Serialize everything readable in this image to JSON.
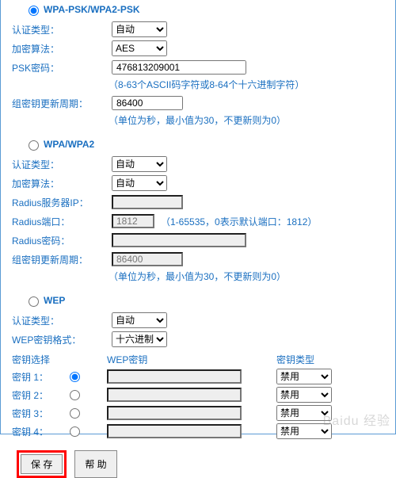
{
  "sec1": {
    "title": "WPA-PSK/WPA2-PSK",
    "radio_checked": true,
    "auth_label": "认证类型：",
    "auth_value": "自动",
    "enc_label": "加密算法：",
    "enc_value": "AES",
    "psk_label": "PSK密码：",
    "psk_value": "476813209001",
    "psk_hint": "（8-63个ASCII码字符或8-64个十六进制字符）",
    "gkey_label": "组密钥更新周期：",
    "gkey_value": "86400",
    "gkey_hint": "（单位为秒，最小值为30，不更新则为0）"
  },
  "sec2": {
    "title": "WPA/WPA2",
    "radio_checked": false,
    "auth_label": "认证类型：",
    "auth_value": "自动",
    "enc_label": "加密算法：",
    "enc_value": "自动",
    "radius_ip_label": "Radius服务器IP：",
    "radius_ip_value": "",
    "radius_port_label": "Radius端口：",
    "radius_port_value": "1812",
    "radius_port_hint": "（1-65535，0表示默认端口：1812）",
    "radius_pw_label": "Radius密码：",
    "radius_pw_value": "",
    "gkey_label": "组密钥更新周期：",
    "gkey_value": "86400",
    "gkey_hint": "（单位为秒，最小值为30，不更新则为0）"
  },
  "sec3": {
    "title": "WEP",
    "radio_checked": false,
    "auth_label": "认证类型：",
    "auth_value": "自动",
    "format_label": "WEP密钥格式：",
    "format_value": "十六进制",
    "hdr_select": "密钥选择",
    "hdr_key": "WEP密钥",
    "hdr_type": "密钥类型",
    "keys": [
      {
        "label": "密钥 1：",
        "checked": true,
        "value": "",
        "type": "禁用"
      },
      {
        "label": "密钥 2：",
        "checked": false,
        "value": "",
        "type": "禁用"
      },
      {
        "label": "密钥 3：",
        "checked": false,
        "value": "",
        "type": "禁用"
      },
      {
        "label": "密钥 4：",
        "checked": false,
        "value": "",
        "type": "禁用"
      }
    ]
  },
  "buttons": {
    "save": "保 存",
    "help": "帮 助"
  },
  "watermark": "Baidu 经验"
}
